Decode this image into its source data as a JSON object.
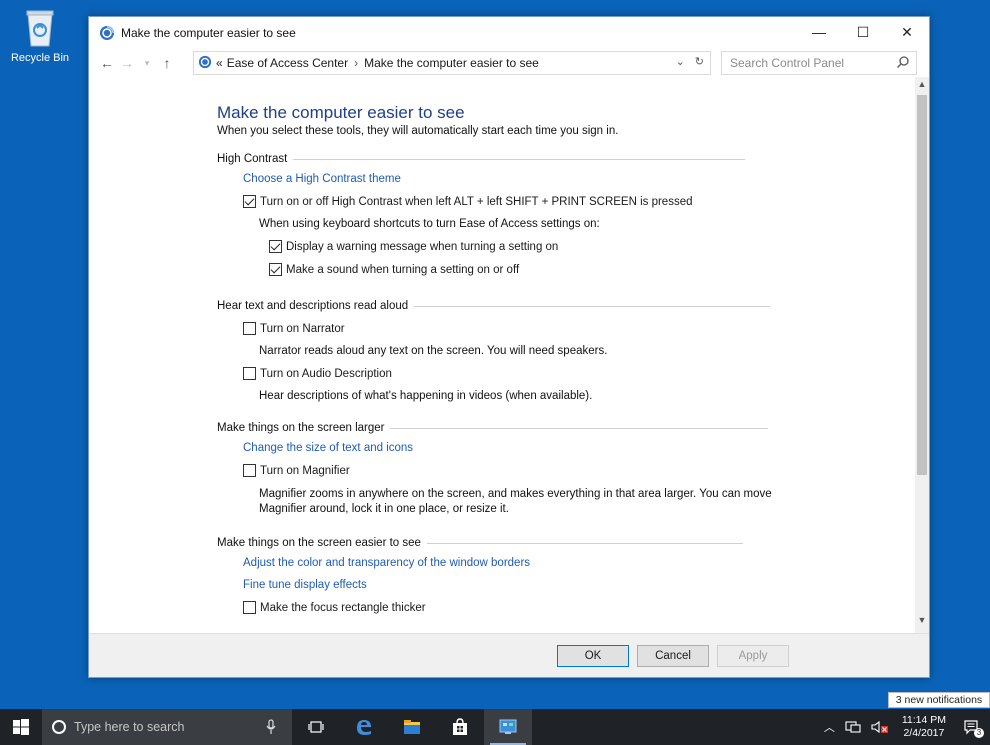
{
  "desktop": {
    "recycle_bin_label": "Recycle Bin"
  },
  "window": {
    "title": "Make the computer easier to see",
    "controls": {
      "minimize": "—",
      "maximize": "☐",
      "close": "✕"
    }
  },
  "address": {
    "prefix": "«",
    "crumbs": [
      "Ease of Access Center",
      "Make the computer easier to see"
    ],
    "separator": "›",
    "search_placeholder": "Search Control Panel"
  },
  "page": {
    "title": "Make the computer easier to see",
    "subtitle": "When you select these tools, they will automatically start each time you sign in.",
    "sections": {
      "high_contrast": {
        "heading": "High Contrast",
        "link": "Choose a High Contrast theme",
        "toggle_label": "Turn on or off High Contrast when left ALT + left SHIFT + PRINT SCREEN is pressed",
        "toggle_checked": true,
        "shortcut_note": "When using keyboard shortcuts to turn Ease of Access settings on:",
        "warning_label": "Display a warning message when turning a setting on",
        "warning_checked": true,
        "sound_label": "Make a sound when turning a setting on or off",
        "sound_checked": true
      },
      "narrator": {
        "heading": "Hear text and descriptions read aloud",
        "narrator_label": "Turn on Narrator",
        "narrator_checked": false,
        "narrator_desc": "Narrator reads aloud any text on the screen. You will need speakers.",
        "audio_label": "Turn on Audio Description",
        "audio_checked": false,
        "audio_desc": "Hear descriptions of what's happening in videos (when available)."
      },
      "larger": {
        "heading": "Make things on the screen larger",
        "link": "Change the size of text and icons",
        "magnifier_label": "Turn on Magnifier",
        "magnifier_checked": false,
        "magnifier_desc_1": "Magnifier zooms in anywhere on the screen, and makes everything in that area larger. You can move",
        "magnifier_desc_2": "Magnifier around, lock it in one place, or resize it."
      },
      "easier": {
        "heading": "Make things on the screen easier to see",
        "link_1": "Adjust the color and transparency of the window borders",
        "link_2": "Fine tune display effects",
        "focus_label": "Make the focus rectangle thicker",
        "focus_checked": false
      }
    }
  },
  "footer": {
    "ok": "OK",
    "cancel": "Cancel",
    "apply": "Apply"
  },
  "notification_toast": "3 new notifications",
  "taskbar": {
    "search_placeholder": "Type here to search",
    "time": "11:14 PM",
    "date": "2/4/2017",
    "notification_count": "3"
  }
}
